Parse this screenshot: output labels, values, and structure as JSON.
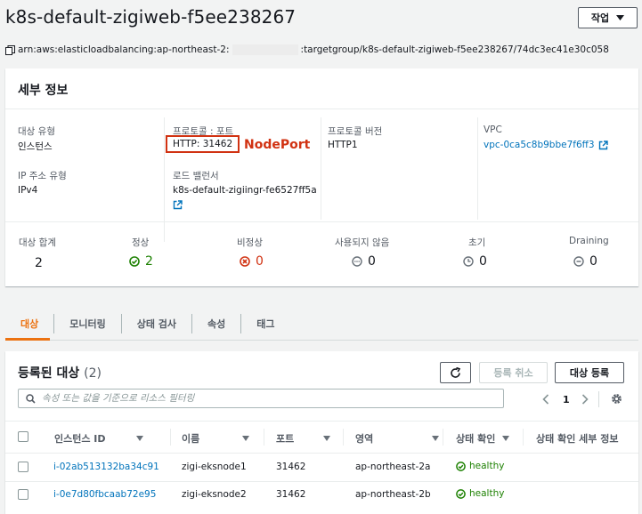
{
  "header": {
    "title": "k8s-default-zigiweb-f5ee238267",
    "actions_label": "작업",
    "arn_prefix": "arn:aws:elasticloadbalancing:ap-northeast-2:",
    "arn_suffix": ":targetgroup/k8s-default-zigiweb-f5ee238267/74dc3ec41e30c058"
  },
  "details": {
    "title": "세부 정보",
    "target_type_label": "대상 유형",
    "target_type_value": "인스턴스",
    "protocol_port_label": "프로토콜 : 포트",
    "protocol_port_value": "HTTP: 31462",
    "annotation": "NodePort",
    "protocol_version_label": "프로토콜 버전",
    "protocol_version_value": "HTTP1",
    "vpc_label": "VPC",
    "vpc_value": "vpc-0ca5c8b9bbe7f6ff3",
    "ip_type_label": "IP 주소 유형",
    "ip_type_value": "IPv4",
    "lb_label": "로드 밸런서",
    "lb_value": "k8s-default-zigiingr-fe6527ff5a"
  },
  "stats": {
    "total_label": "대상 합계",
    "total_value": "2",
    "healthy_label": "정상",
    "healthy_value": "2",
    "unhealthy_label": "비정상",
    "unhealthy_value": "0",
    "unused_label": "사용되지 않음",
    "unused_value": "0",
    "initial_label": "초기",
    "initial_value": "0",
    "draining_label": "Draining",
    "draining_value": "0",
    "colors": {
      "healthy": "#1d8102",
      "unhealthy": "#d13212",
      "neutral": "#687078"
    }
  },
  "tabs": [
    {
      "label": "대상",
      "active": true
    },
    {
      "label": "모니터링",
      "active": false
    },
    {
      "label": "상태 검사",
      "active": false
    },
    {
      "label": "속성",
      "active": false
    },
    {
      "label": "태그",
      "active": false
    }
  ],
  "targets": {
    "title": "등록된 대상",
    "count": "(2)",
    "deregister_label": "등록 취소",
    "register_label": "대상 등록",
    "filter_placeholder": "속성 또는 값을 기준으로 리소스 필터링",
    "page": "1",
    "columns": {
      "instance_id": "인스턴스 ID",
      "name": "이름",
      "port": "포트",
      "zone": "영역",
      "health": "상태 확인",
      "health_details": "상태 확인 세부 정보"
    },
    "rows": [
      {
        "instance_id": "i-02ab513132ba34c91",
        "name": "zigi-eksnode1",
        "port": "31462",
        "zone": "ap-northeast-2a",
        "health": "healthy"
      },
      {
        "instance_id": "i-0e7d80fbcaab72e95",
        "name": "zigi-eksnode2",
        "port": "31462",
        "zone": "ap-northeast-2b",
        "health": "healthy"
      }
    ]
  },
  "icons": [
    "caret-down-icon",
    "copy-icon",
    "external-link-icon",
    "check-circle-icon",
    "x-circle-icon",
    "dots-circle-icon",
    "clock-icon",
    "minus-circle-icon",
    "refresh-icon",
    "search-icon",
    "chevron-left-icon",
    "chevron-right-icon",
    "gear-icon",
    "sort-icon"
  ]
}
